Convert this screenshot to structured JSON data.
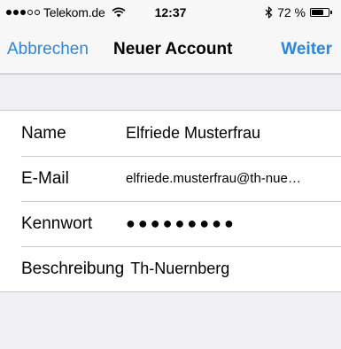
{
  "status_bar": {
    "carrier": "Telekom.de",
    "time": "12:37",
    "battery_text": "72 %",
    "battery_level": 0.72,
    "signal_bars_filled": 3,
    "signal_bars_total": 5,
    "icons": [
      "wifi-icon",
      "bluetooth-icon",
      "battery-icon"
    ]
  },
  "navbar": {
    "cancel_label": "Abbrechen",
    "title": "Neuer Account",
    "next_label": "Weiter",
    "accent_color": "#2a86e0"
  },
  "form": {
    "rows": [
      {
        "label": "Name",
        "value": "Elfriede Musterfrau"
      },
      {
        "label": "E-Mail",
        "value": "elfriede.musterfrau@th-nue…"
      },
      {
        "label": "Kennwort",
        "value": "●●●●●●●●●"
      },
      {
        "label": "Beschreibung",
        "value": "Th-Nuernberg"
      }
    ]
  }
}
